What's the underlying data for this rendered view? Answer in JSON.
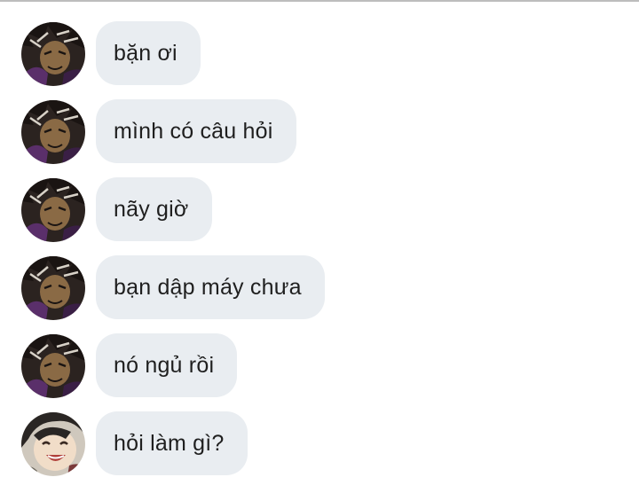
{
  "conversation": {
    "messages": [
      {
        "text": "bặn ơi",
        "avatar_icon": "dark-haired-character-avatar-icon"
      },
      {
        "text": "mình có câu hỏi",
        "avatar_icon": "dark-haired-character-avatar-icon"
      },
      {
        "text": "nãy giờ",
        "avatar_icon": "dark-haired-character-avatar-icon"
      },
      {
        "text": "bạn dập máy chưa",
        "avatar_icon": "dark-haired-character-avatar-icon"
      },
      {
        "text": "nó ngủ rồi",
        "avatar_icon": "dark-haired-character-avatar-icon"
      },
      {
        "text": "hỏi làm gì?",
        "avatar_icon": "laughing-character-avatar-icon"
      }
    ]
  },
  "colors": {
    "bubble_bg": "#e9edf1",
    "text": "#1f1f1f",
    "divider": "#bdbdbd"
  }
}
